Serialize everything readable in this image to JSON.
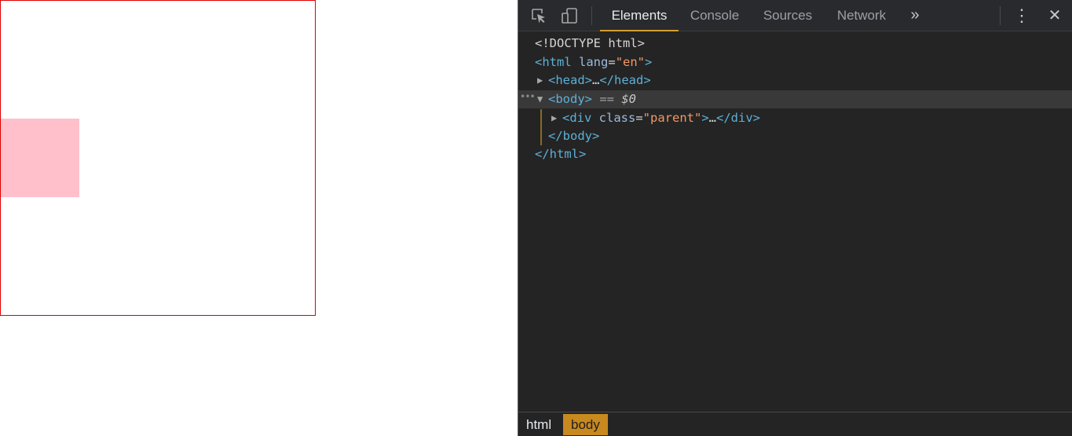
{
  "devtools": {
    "tabs": [
      {
        "label": "Elements",
        "active": true
      },
      {
        "label": "Console",
        "active": false
      },
      {
        "label": "Sources",
        "active": false
      },
      {
        "label": "Network",
        "active": false
      }
    ],
    "more_tabs_glyph": "»",
    "menu_glyph": "⋮",
    "close_glyph": "✕",
    "icons": [
      "element-picker-icon",
      "device-toolbar-icon",
      "chevron-double-right-icon",
      "kebab-menu-icon",
      "close-icon"
    ],
    "accent_color": "#d59d32"
  },
  "tree": {
    "doctype": "<!DOCTYPE html>",
    "html_open_tag": "<html",
    "html_lang_attr": " lang",
    "html_lang_val": "\"en\"",
    "html_open_close": ">",
    "head_collapsed": "<head>",
    "head_ellipsis": "…",
    "head_close": "</head>",
    "body_open": "<body>",
    "body_selected_marker": " == ",
    "body_dollar": "$0",
    "div_open": "<div",
    "div_class_attr": " class",
    "div_class_val": "\"parent\"",
    "div_open_close": ">",
    "div_ellipsis": "…",
    "div_close": "</div>",
    "body_close": "</body>",
    "html_close": "</html>",
    "eq_sign": "="
  },
  "breadcrumbs": [
    {
      "label": "html",
      "active": false
    },
    {
      "label": "body",
      "active": true
    }
  ],
  "page": {
    "parent_border_color": "#e00000",
    "child_color": "#ffc0cb"
  }
}
